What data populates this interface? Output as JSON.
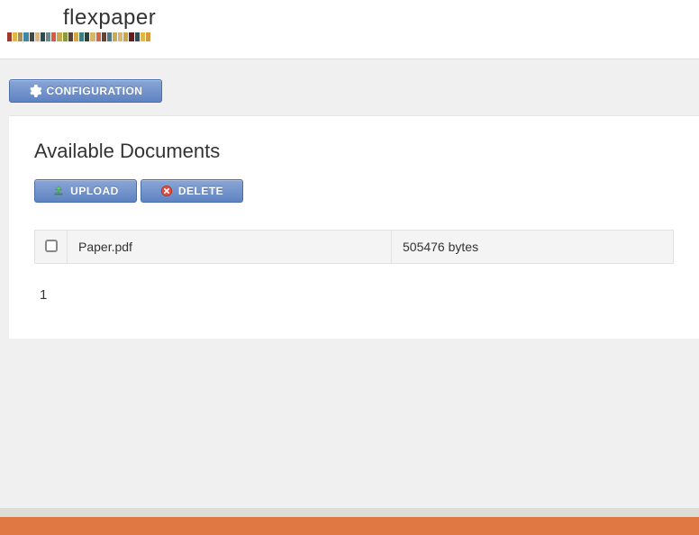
{
  "header": {
    "brand": "flexpaper",
    "stripe_colors": [
      "#9c3a2e",
      "#e0b84a",
      "#a58f5f",
      "#3c86a8",
      "#434746",
      "#e0b37a",
      "#2d4d55",
      "#6a8a8e",
      "#d95b3d",
      "#c7a951",
      "#8a9b3e",
      "#58413a",
      "#d4a84a",
      "#3b7c86",
      "#2e3f3c",
      "#d8b667",
      "#d06a46",
      "#6d3c32",
      "#4a7a85",
      "#c9aa55",
      "#d6b76b",
      "#cfa44a",
      "#5f1f1a",
      "#2f4f54",
      "#e0b84a",
      "#d39a42"
    ]
  },
  "toolbar": {
    "configuration_label": "CONFIGURATION"
  },
  "panel": {
    "title": "Available Documents",
    "upload_label": "UPLOAD",
    "delete_label": "DELETE"
  },
  "documents": [
    {
      "name": "Paper.pdf",
      "size": "505476 bytes"
    }
  ],
  "pagination": {
    "current": "1"
  }
}
